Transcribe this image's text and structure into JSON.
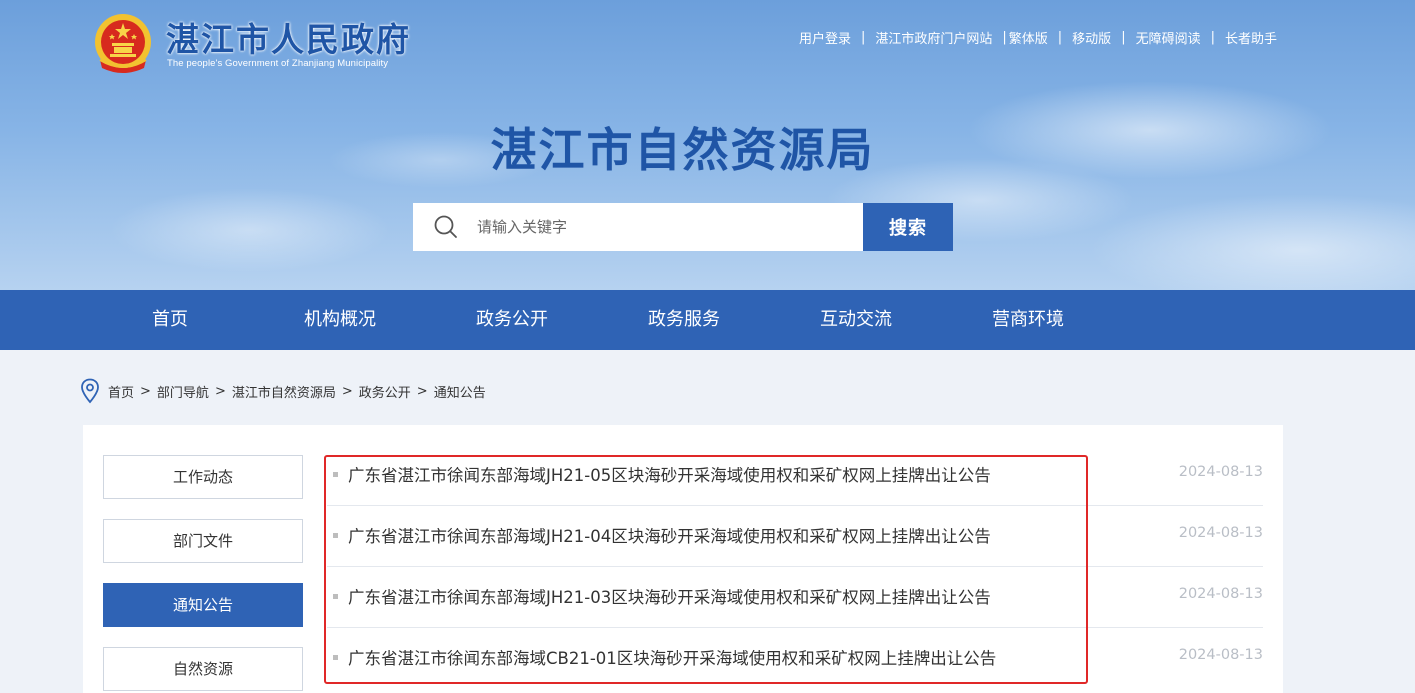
{
  "header": {
    "site_title": "湛江市人民政府",
    "site_subtitle": "The people's Government of Zhanjiang Municipality",
    "bureau_title": "湛江市自然资源局",
    "top_links": [
      "用户登录",
      "湛江市政府门户网站",
      "繁体版",
      "移动版",
      "无障碍阅读",
      "长者助手"
    ],
    "emblem_icon": "national-emblem-icon"
  },
  "search": {
    "placeholder": "请输入关键字",
    "button_label": "搜索",
    "icon": "search-icon"
  },
  "nav": {
    "items": [
      "首页",
      "机构概况",
      "政务公开",
      "政务服务",
      "互动交流",
      "营商环境"
    ]
  },
  "breadcrumb": {
    "icon": "location-pin-icon",
    "items": [
      "首页",
      "部门导航",
      "湛江市自然资源局",
      "政务公开",
      "通知公告"
    ],
    "separator": ">"
  },
  "sidebar": {
    "items": [
      "工作动态",
      "部门文件",
      "通知公告",
      "自然资源"
    ],
    "active": "通知公告"
  },
  "list": {
    "items": [
      {
        "title": "广东省湛江市徐闻东部海域JH21-05区块海砂开采海域使用权和采矿权网上挂牌出让公告",
        "date": "2024-08-13"
      },
      {
        "title": "广东省湛江市徐闻东部海域JH21-04区块海砂开采海域使用权和采矿权网上挂牌出让公告",
        "date": "2024-08-13"
      },
      {
        "title": "广东省湛江市徐闻东部海域JH21-03区块海砂开采海域使用权和采矿权网上挂牌出让公告",
        "date": "2024-08-13"
      },
      {
        "title": "广东省湛江市徐闻东部海域CB21-01区块海砂开采海域使用权和采矿权网上挂牌出让公告",
        "date": "2024-08-13"
      }
    ]
  },
  "colors": {
    "brand_blue": "#2f63b5",
    "title_blue": "#1f55a6",
    "highlight_red": "#e02828"
  }
}
